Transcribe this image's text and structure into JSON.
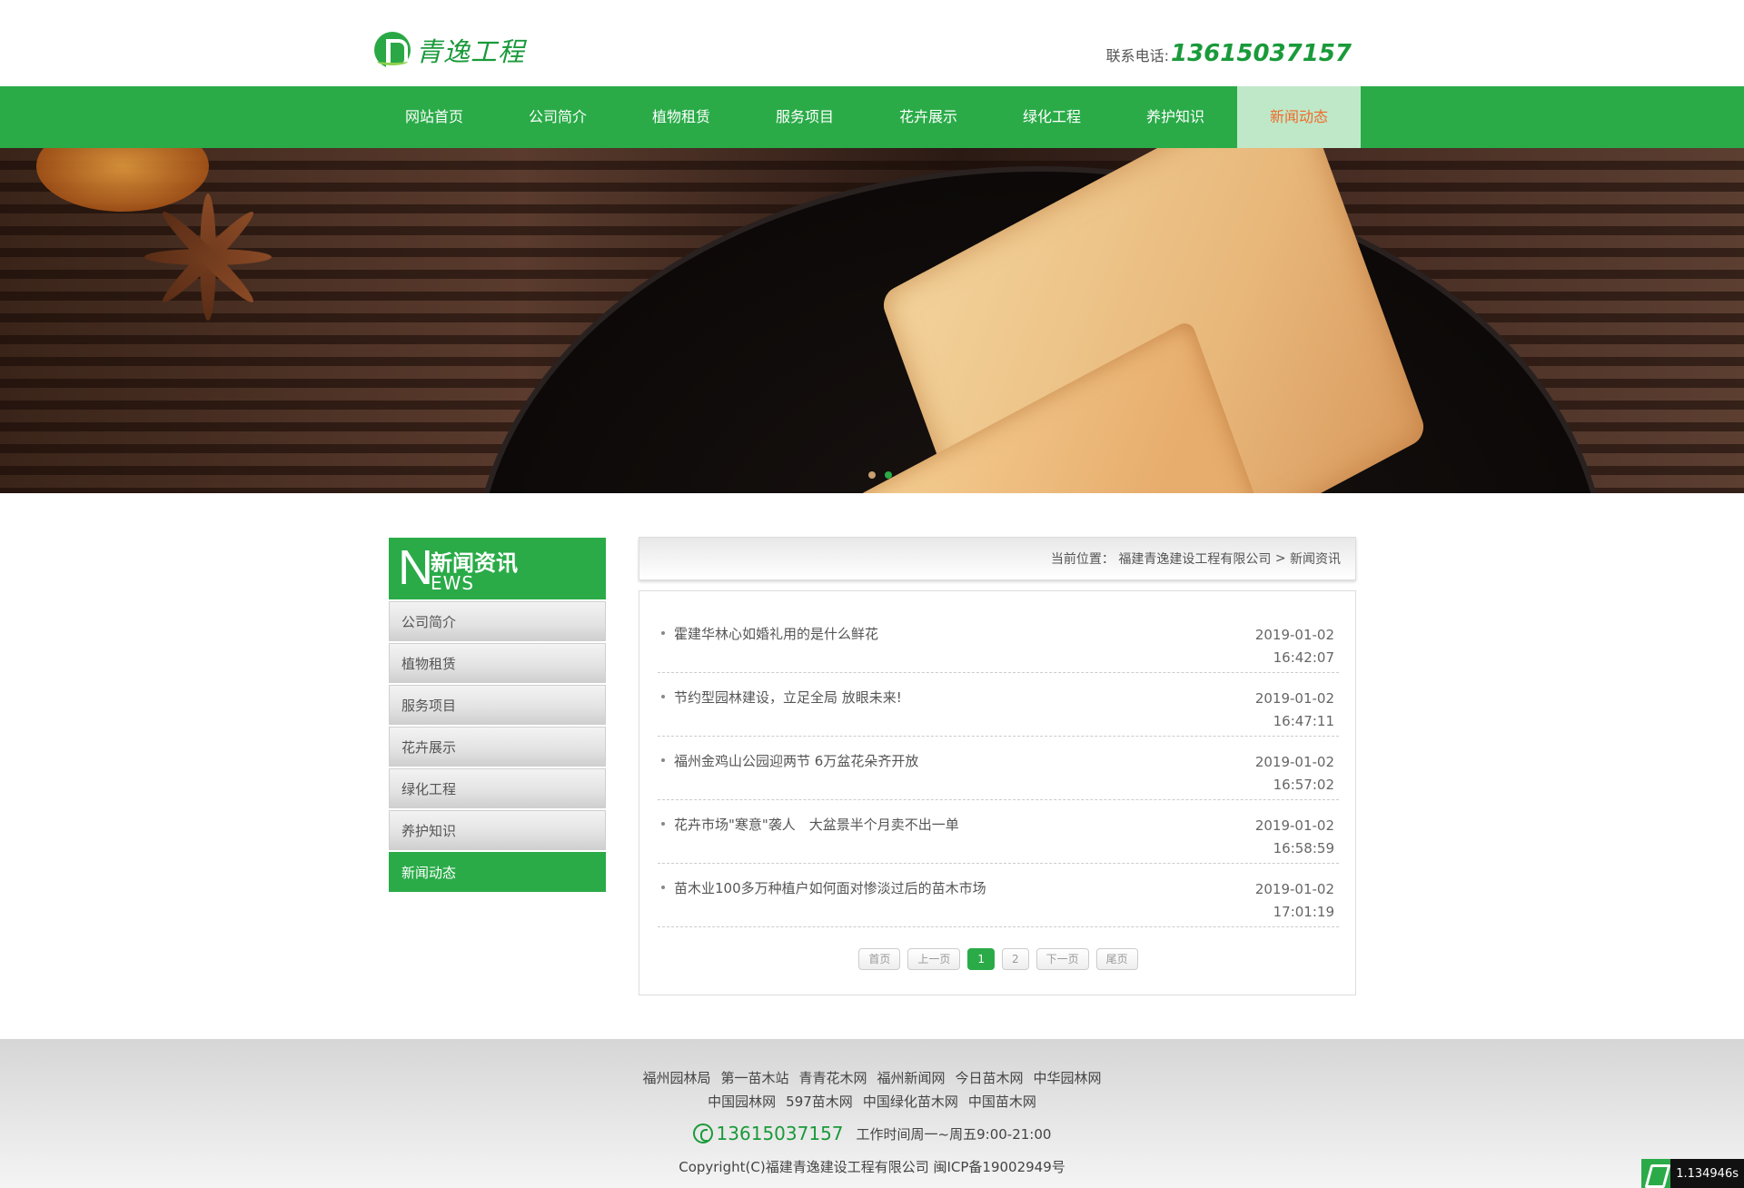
{
  "header": {
    "logo_text": "青逸工程",
    "phone_label": "联系电话:",
    "phone_number": "13615037157"
  },
  "nav": {
    "items": [
      {
        "label": "网站首页"
      },
      {
        "label": "公司简介"
      },
      {
        "label": "植物租赁"
      },
      {
        "label": "服务项目"
      },
      {
        "label": "花卉展示"
      },
      {
        "label": "绿化工程"
      },
      {
        "label": "养护知识"
      },
      {
        "label": "新闻动态"
      }
    ],
    "active_index": 7
  },
  "banner": {
    "slide_count": 2,
    "active_slide": 2
  },
  "sidebar": {
    "letter": "N",
    "title": "新闻资讯",
    "subtitle": "EWS",
    "items": [
      {
        "label": "公司简介"
      },
      {
        "label": "植物租赁"
      },
      {
        "label": "服务项目"
      },
      {
        "label": "花卉展示"
      },
      {
        "label": "绿化工程"
      },
      {
        "label": "养护知识"
      },
      {
        "label": "新闻动态"
      }
    ],
    "active_index": 6
  },
  "breadcrumb": {
    "prefix": "当前位置：",
    "company": "福建青逸建设工程有限公司",
    "separator": ">",
    "current": "新闻资讯"
  },
  "news": {
    "items": [
      {
        "title": "霍建华林心如婚礼用的是什么鲜花",
        "date": "2019-01-02",
        "time": "16:42:07"
      },
      {
        "title": "节约型园林建设，立足全局 放眼未来!",
        "date": "2019-01-02",
        "time": "16:47:11"
      },
      {
        "title": "福州金鸡山公园迎两节 6万盆花朵齐开放",
        "date": "2019-01-02",
        "time": "16:57:02"
      },
      {
        "title": "花卉市场\"寒意\"袭人　大盆景半个月卖不出一单",
        "date": "2019-01-02",
        "time": "16:58:59"
      },
      {
        "title": "苗木业100多万种植户如何面对惨淡过后的苗木市场",
        "date": "2019-01-02",
        "time": "17:01:19"
      }
    ]
  },
  "pager": {
    "first": "首页",
    "prev": "上一页",
    "pages": [
      "1",
      "2"
    ],
    "current": "1",
    "next": "下一页",
    "last": "尾页"
  },
  "footer": {
    "links_row1": [
      "福州园林局",
      "第一苗木站",
      "青青花木网",
      "福州新闻网",
      "今日苗木网",
      "中华园林网"
    ],
    "links_row2": [
      "中国园林网",
      "597苗木网",
      "中国绿化苗木网",
      "中国苗木网"
    ],
    "phone": "13615037157",
    "hours": "工作时间周一~周五9:00-21:00",
    "copyright": "Copyright(C)福建青逸建设工程有限公司 闽ICP备19002949号"
  },
  "perf_badge": "1.134946s",
  "colors": {
    "brand_green": "#2aab48",
    "active_nav_bg": "#bfe8c8",
    "active_nav_text": "#f06a2a"
  }
}
